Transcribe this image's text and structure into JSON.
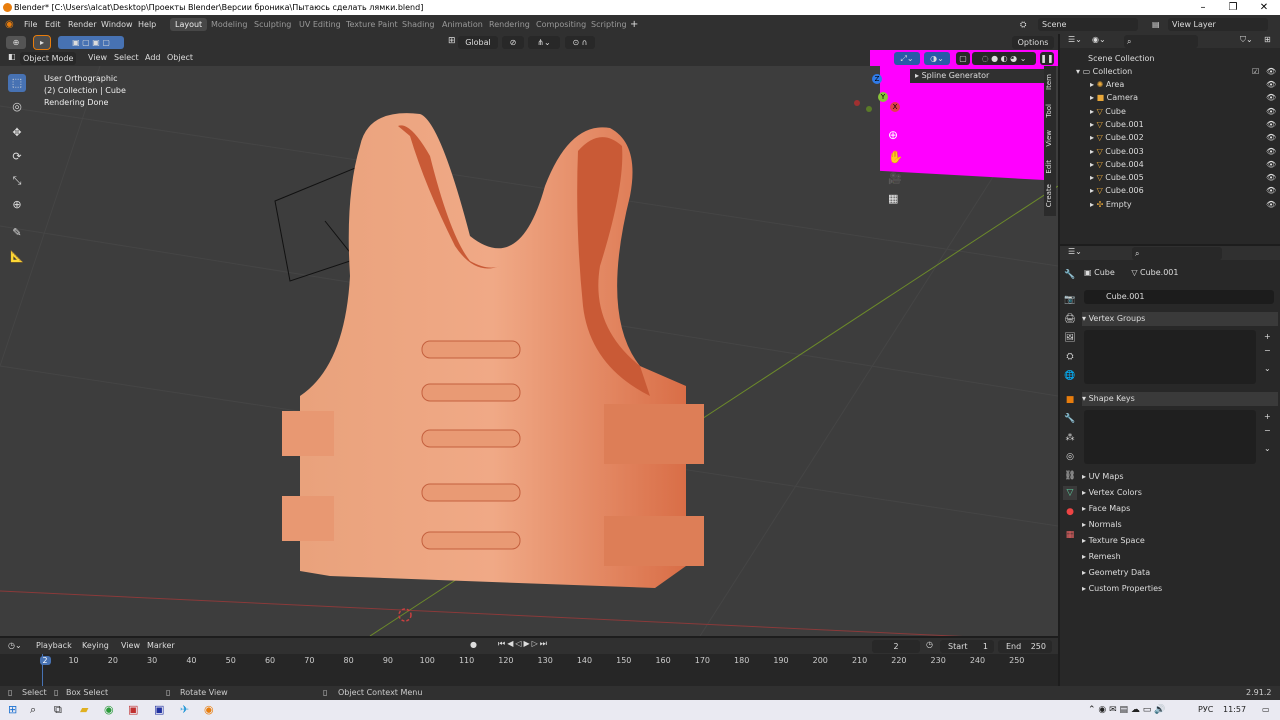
{
  "window": {
    "title": "Blender* [C:\\Users\\alcat\\Desktop\\Проекты Blender\\Версии броника\\Пытаюсь сделать лямки.blend]",
    "minimize": "–",
    "restore": "❐",
    "close": "✕"
  },
  "menubar": {
    "items": [
      "File",
      "Edit",
      "Render",
      "Window",
      "Help"
    ],
    "workspaces": [
      "Layout",
      "Modeling",
      "Sculpting",
      "UV Editing",
      "Texture Paint",
      "Shading",
      "Animation",
      "Rendering",
      "Compositing",
      "Scripting"
    ],
    "active_workspace": "Layout",
    "add_workspace": "+",
    "scene_label": "Scene",
    "view_layer_label": "View Layer"
  },
  "toolbar": {
    "transform_orientation": "Global",
    "options_label": "Options"
  },
  "viewport_header": {
    "mode": "Object Mode",
    "menus": [
      "View",
      "Select",
      "Add",
      "Object"
    ]
  },
  "viewport": {
    "overlay_line1": "User Orthographic",
    "overlay_line2": "(2) Collection | Cube",
    "overlay_line3": "Rendering Done",
    "nav_x": "X",
    "nav_y": "Y",
    "nav_z": "Z",
    "spline_panel_title": "Spline Generator",
    "sidebar_tabs": [
      "Item",
      "Tool",
      "View",
      "Edit",
      "Create"
    ],
    "highlight_color": "#ff00ff",
    "object_color": "#e58d6a"
  },
  "outliner": {
    "root": "Scene Collection",
    "collection": "Collection",
    "items": [
      {
        "name": "Area",
        "icon": "light-icon"
      },
      {
        "name": "Camera",
        "icon": "camera-icon"
      },
      {
        "name": "Cube",
        "icon": "mesh-icon"
      },
      {
        "name": "Cube.001",
        "icon": "mesh-icon"
      },
      {
        "name": "Cube.002",
        "icon": "mesh-icon"
      },
      {
        "name": "Cube.003",
        "icon": "mesh-icon"
      },
      {
        "name": "Cube.004",
        "icon": "mesh-icon"
      },
      {
        "name": "Cube.005",
        "icon": "mesh-icon"
      },
      {
        "name": "Cube.006",
        "icon": "mesh-icon"
      },
      {
        "name": "Empty",
        "icon": "empty-icon"
      }
    ]
  },
  "properties": {
    "breadcrumb_object": "Cube",
    "breadcrumb_data": "Cube.001",
    "mesh_name": "Cube.001",
    "sections": [
      "Vertex Groups",
      "Shape Keys"
    ],
    "collapsed_sections": [
      "UV Maps",
      "Vertex Colors",
      "Face Maps",
      "Normals",
      "Texture Space",
      "Remesh",
      "Geometry Data",
      "Custom Properties"
    ]
  },
  "timeline": {
    "menus": [
      "Playback",
      "Keying",
      "View",
      "Marker"
    ],
    "current_frame": "2",
    "start_label": "Start",
    "start_value": "1",
    "end_label": "End",
    "end_value": "250",
    "ticks": [
      "2",
      "10",
      "20",
      "30",
      "40",
      "50",
      "60",
      "70",
      "80",
      "90",
      "100",
      "110",
      "120",
      "130",
      "140",
      "150",
      "160",
      "170",
      "180",
      "190",
      "200",
      "210",
      "220",
      "230",
      "240",
      "250"
    ]
  },
  "statusbar": {
    "select": "Select",
    "box_select": "Box Select",
    "rotate": "Rotate View",
    "context_menu": "Object Context Menu",
    "version": "2.91.2"
  },
  "taskbar": {
    "lang": "РУС",
    "time": "11:57"
  }
}
